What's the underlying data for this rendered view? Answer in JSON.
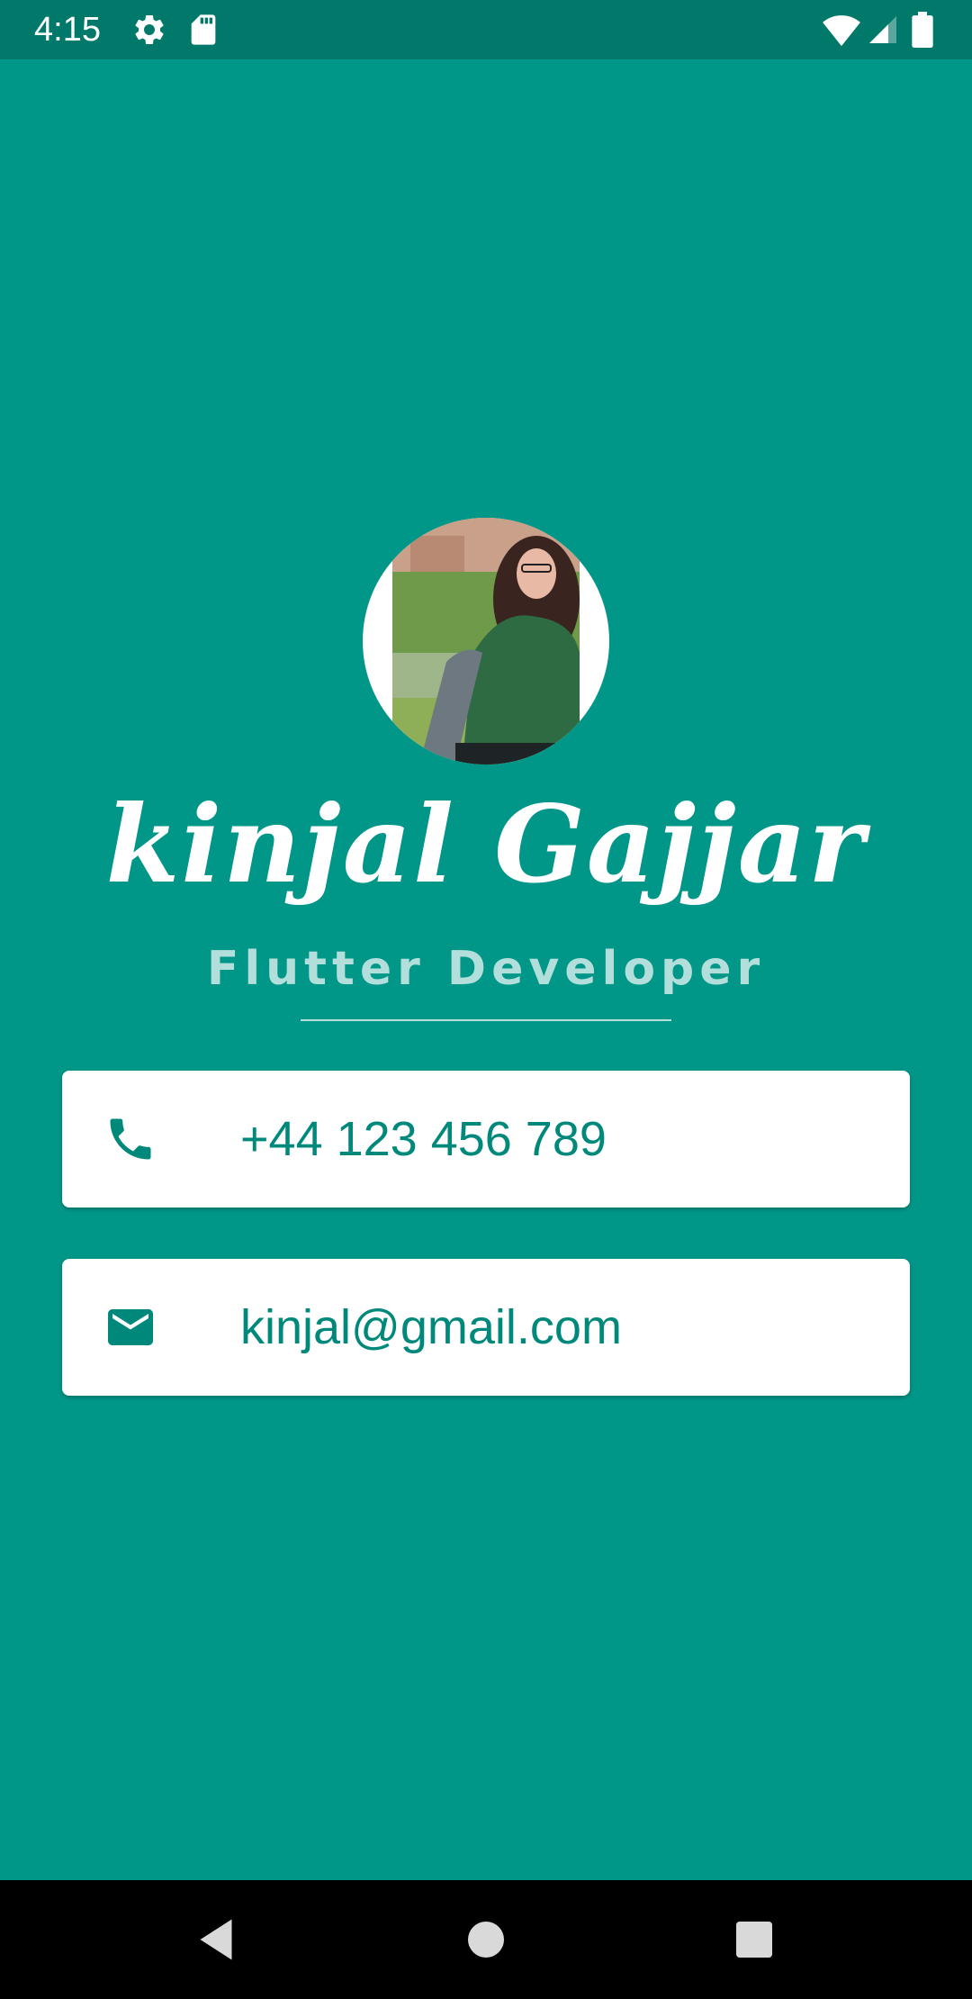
{
  "status_bar": {
    "time": "4:15",
    "icons": [
      "gear-icon",
      "sd-card-icon",
      "wifi-icon",
      "signal-icon",
      "battery-icon"
    ]
  },
  "profile": {
    "name": "kinjal Gajjar",
    "title": "Flutter Developer"
  },
  "contacts": {
    "phone": {
      "icon": "phone-icon",
      "value": "+44 123 456 789"
    },
    "email": {
      "icon": "mail-icon",
      "value": "kinjal@gmail.com"
    }
  },
  "nav_bar": {
    "buttons": [
      "back-icon",
      "home-icon",
      "recents-icon"
    ]
  },
  "colors": {
    "background": "#009688",
    "status_bar": "#00796b",
    "accent_text": "#00897b",
    "subtitle": "#b2dfdb",
    "card": "#ffffff"
  }
}
